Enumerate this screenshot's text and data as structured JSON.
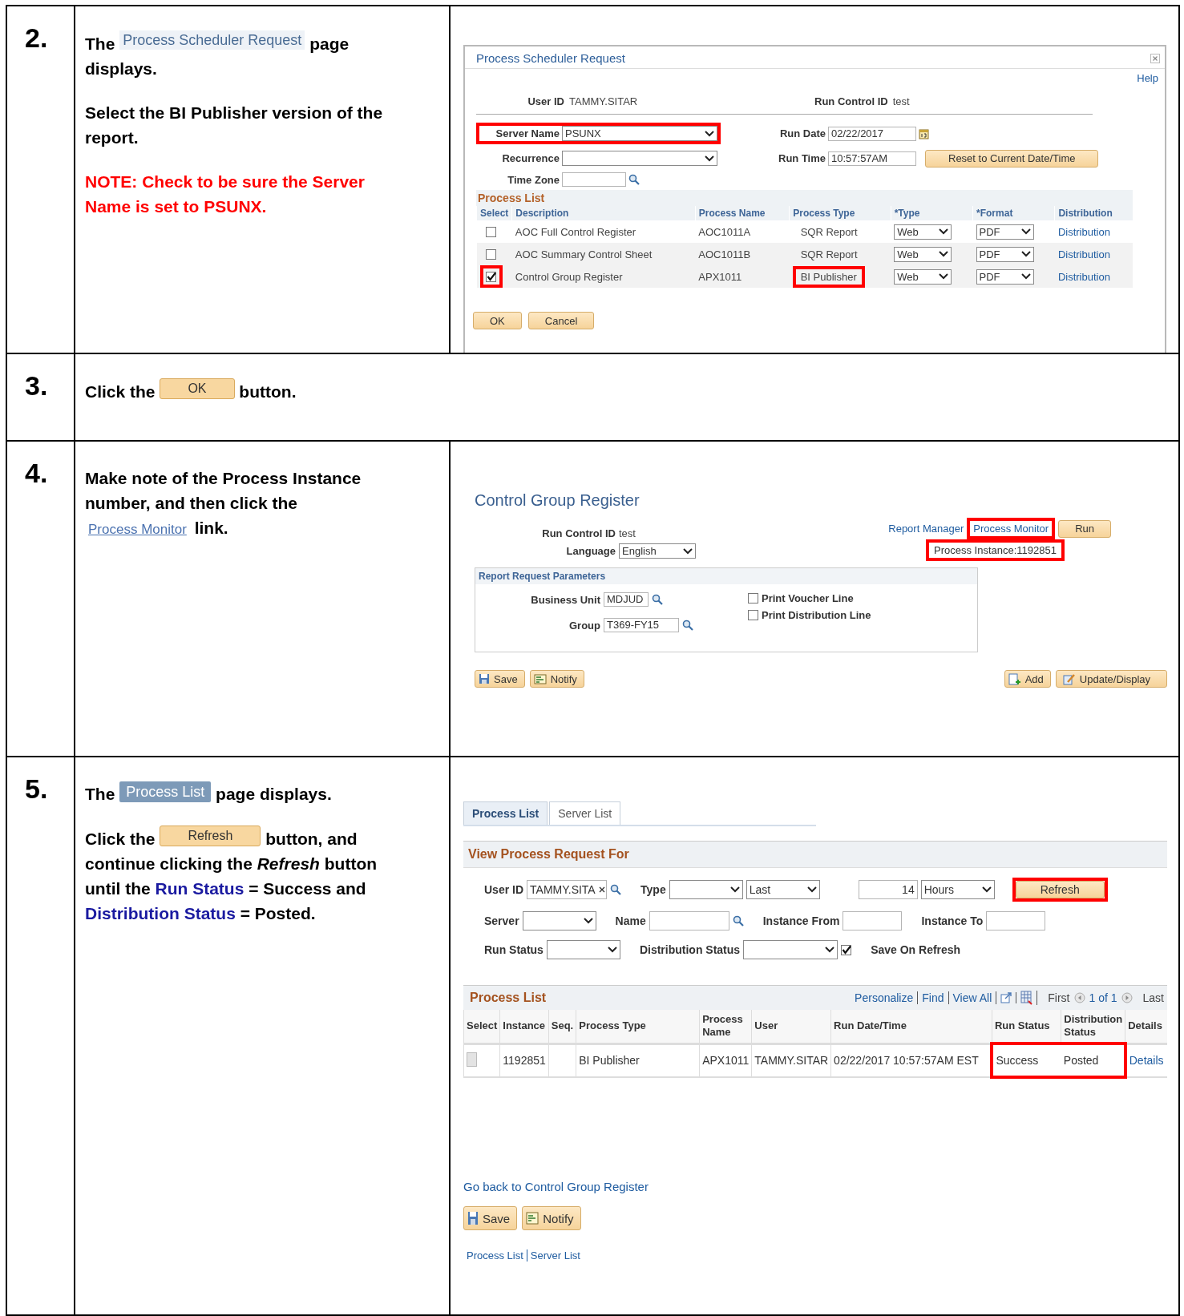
{
  "steps": [
    {
      "number": "2.",
      "paragraphs": [
        {
          "kind": "body",
          "lines": [
            [
              {
                "kind": "text",
                "text": "The"
              },
              {
                "kind": "page-chip",
                "text": "Process Scheduler Request"
              },
              {
                "kind": "text",
                "text": "page"
              }
            ],
            [
              {
                "kind": "text",
                "text": "displays."
              }
            ]
          ]
        },
        {
          "kind": "body",
          "lines": [
            [
              {
                "kind": "text",
                "text": "Select the BI Publisher version of the"
              }
            ],
            [
              {
                "kind": "text",
                "text": "report."
              }
            ]
          ]
        },
        {
          "kind": "note",
          "lines": [
            [
              {
                "kind": "text",
                "text": "NOTE: Check to be sure the Server"
              }
            ],
            [
              {
                "kind": "text",
                "text": "Name is set to PSUNX."
              }
            ]
          ]
        }
      ],
      "screen": {
        "kind": "scheduler",
        "title": "Process Scheduler Request",
        "help": "Help",
        "user_id": {
          "label": "User ID",
          "value": "TAMMY.SITAR"
        },
        "run_control_id": {
          "label": "Run Control ID",
          "value": "test"
        },
        "server_name": {
          "label": "Server Name",
          "value": "PSUNX",
          "highlighted": true
        },
        "recurrence": {
          "label": "Recurrence"
        },
        "time_zone": {
          "label": "Time Zone"
        },
        "run_date": {
          "label": "Run Date",
          "value": "02/22/2017"
        },
        "run_time": {
          "label": "Run Time",
          "value": "10:57:57AM"
        },
        "reset_button": "Reset to Current Date/Time",
        "process_list": {
          "title": "Process List",
          "columns": [
            "Select",
            "Description",
            "Process Name",
            "Process Type",
            "*Type",
            "*Format",
            "Distribution"
          ],
          "rows": [
            {
              "checked": false,
              "highlighted": false,
              "description": "AOC Full Control Register",
              "process_name": "AOC1011A",
              "process_type": "SQR Report",
              "type": "Web",
              "format": "PDF",
              "distribution": "Distribution"
            },
            {
              "checked": false,
              "highlighted": false,
              "description": "AOC Summary Control Sheet",
              "process_name": "AOC1011B",
              "process_type": "SQR Report",
              "type": "Web",
              "format": "PDF",
              "distribution": "Distribution"
            },
            {
              "checked": true,
              "highlighted": true,
              "description": "Control Group Register",
              "process_name": "APX1011",
              "process_type": "BI Publisher",
              "type": "Web",
              "format": "PDF",
              "distribution": "Distribution"
            }
          ]
        },
        "buttons": [
          "OK",
          "Cancel"
        ]
      }
    },
    {
      "number": "3.",
      "paragraphs": [
        {
          "kind": "body",
          "lines": [
            [
              {
                "kind": "text",
                "text": "Click the"
              },
              {
                "kind": "button-chip",
                "text": "OK"
              },
              {
                "kind": "text",
                "text": "button."
              }
            ]
          ]
        }
      ]
    },
    {
      "number": "4.",
      "paragraphs": [
        {
          "kind": "body",
          "lines": [
            [
              {
                "kind": "text",
                "text": "Make note of the Process Instance"
              }
            ],
            [
              {
                "kind": "text",
                "text": "number, and then click the"
              }
            ],
            [
              {
                "kind": "link-chip",
                "text": "Process Monitor"
              },
              {
                "kind": "text",
                "text": "link."
              }
            ]
          ]
        }
      ],
      "screen": {
        "kind": "run-control",
        "title": "Control Group Register",
        "run_control_id": {
          "label": "Run Control ID",
          "value": "test"
        },
        "language": {
          "label": "Language",
          "value": "English"
        },
        "report_manager": "Report Manager",
        "process_monitor": {
          "text": "Process Monitor",
          "highlighted": true
        },
        "run_button": "Run",
        "process_instance": {
          "text": "Process Instance:1192851",
          "highlighted": true
        },
        "parameters": {
          "title": "Report Request Parameters",
          "business_unit": {
            "label": "Business Unit",
            "value": "MDJUD"
          },
          "group": {
            "label": "Group",
            "value": "T369-FY15"
          },
          "checkboxes": [
            {
              "label": "Print Voucher Line",
              "checked": false
            },
            {
              "label": "Print Distribution Line",
              "checked": false
            }
          ]
        },
        "left_buttons": [
          {
            "kind": "save",
            "label": "Save"
          },
          {
            "kind": "notify",
            "label": "Notify"
          }
        ],
        "right_buttons": [
          {
            "kind": "add",
            "label": "Add"
          },
          {
            "kind": "update",
            "label": "Update/Display"
          }
        ]
      }
    },
    {
      "number": "5.",
      "paragraphs": [
        {
          "kind": "body",
          "lines": [
            [
              {
                "kind": "text",
                "text": "The"
              },
              {
                "kind": "tab-chip",
                "text": "Process List"
              },
              {
                "kind": "text",
                "text": "page displays."
              }
            ]
          ]
        },
        {
          "kind": "body",
          "lines": [
            [
              {
                "kind": "text",
                "text": "Click the"
              },
              {
                "kind": "button-chip",
                "text": "Refresh"
              },
              {
                "kind": "text",
                "text": "button, and"
              }
            ],
            [
              {
                "kind": "text",
                "text": "continue clicking the *Refresh* button"
              }
            ],
            [
              {
                "kind": "text",
                "text": "until the"
              },
              {
                "kind": "term",
                "text": "Run Status"
              },
              {
                "kind": "text",
                "text": "= Success and"
              }
            ],
            [
              {
                "kind": "term",
                "text": "Distribution Status"
              },
              {
                "kind": "text",
                "text": "= Posted."
              }
            ]
          ]
        }
      ],
      "screen": {
        "kind": "process-monitor",
        "tabs": [
          {
            "label": "Process List",
            "selected": true
          },
          {
            "label": "Server List",
            "selected": false
          }
        ],
        "section_title": "View Process Request For",
        "filter_rows": [
          [
            {
              "kind": "lookup",
              "label": "User ID",
              "value": "TAMMY.SITA",
              "clearable": true
            },
            {
              "kind": "dropdown",
              "label": "Type"
            },
            {
              "kind": "dropdown",
              "value": "Last"
            },
            {
              "kind": "number",
              "value": "14"
            },
            {
              "kind": "dropdown",
              "value": "Hours"
            },
            {
              "kind": "button",
              "label": "Refresh",
              "highlighted": true
            }
          ],
          [
            {
              "kind": "dropdown",
              "label": "Server"
            },
            {
              "kind": "lookup",
              "label": "Name",
              "clearable": false
            },
            {
              "kind": "input",
              "label": "Instance From"
            },
            {
              "kind": "input",
              "label": "Instance To"
            }
          ],
          [
            {
              "kind": "dropdown",
              "label": "Run Status"
            },
            {
              "kind": "dropdown",
              "label": "Distribution Status"
            },
            {
              "kind": "checkbox",
              "label": "Save On Refresh",
              "checked": true
            }
          ]
        ],
        "grid": {
          "title": "Process List",
          "links": [
            "Personalize",
            "Find",
            "View All"
          ],
          "first": "First",
          "count": "1 of 1",
          "last": "Last",
          "columns": [
            "Select",
            "Instance",
            "Seq.",
            "Process Type",
            "Process Name",
            "User",
            "Run Date/Time",
            "Run Status",
            "Distribution Status",
            "Details"
          ],
          "rows": [
            {
              "checked": false,
              "instance": "1192851",
              "process_type": "BI Publisher",
              "process_name": "APX1011",
              "user": "TAMMY.SITAR",
              "run_datetime": "02/22/2017 10:57:57AM EST",
              "run_status": "Success",
              "distribution_status": "Posted",
              "details": "Details",
              "status_highlighted": true
            }
          ]
        },
        "back_link": "Go back to Control Group Register",
        "buttons": [
          {
            "kind": "save",
            "label": "Save"
          },
          {
            "kind": "notify",
            "label": "Notify"
          }
        ],
        "bottom_links": [
          "Process List",
          "Server List"
        ]
      }
    }
  ]
}
